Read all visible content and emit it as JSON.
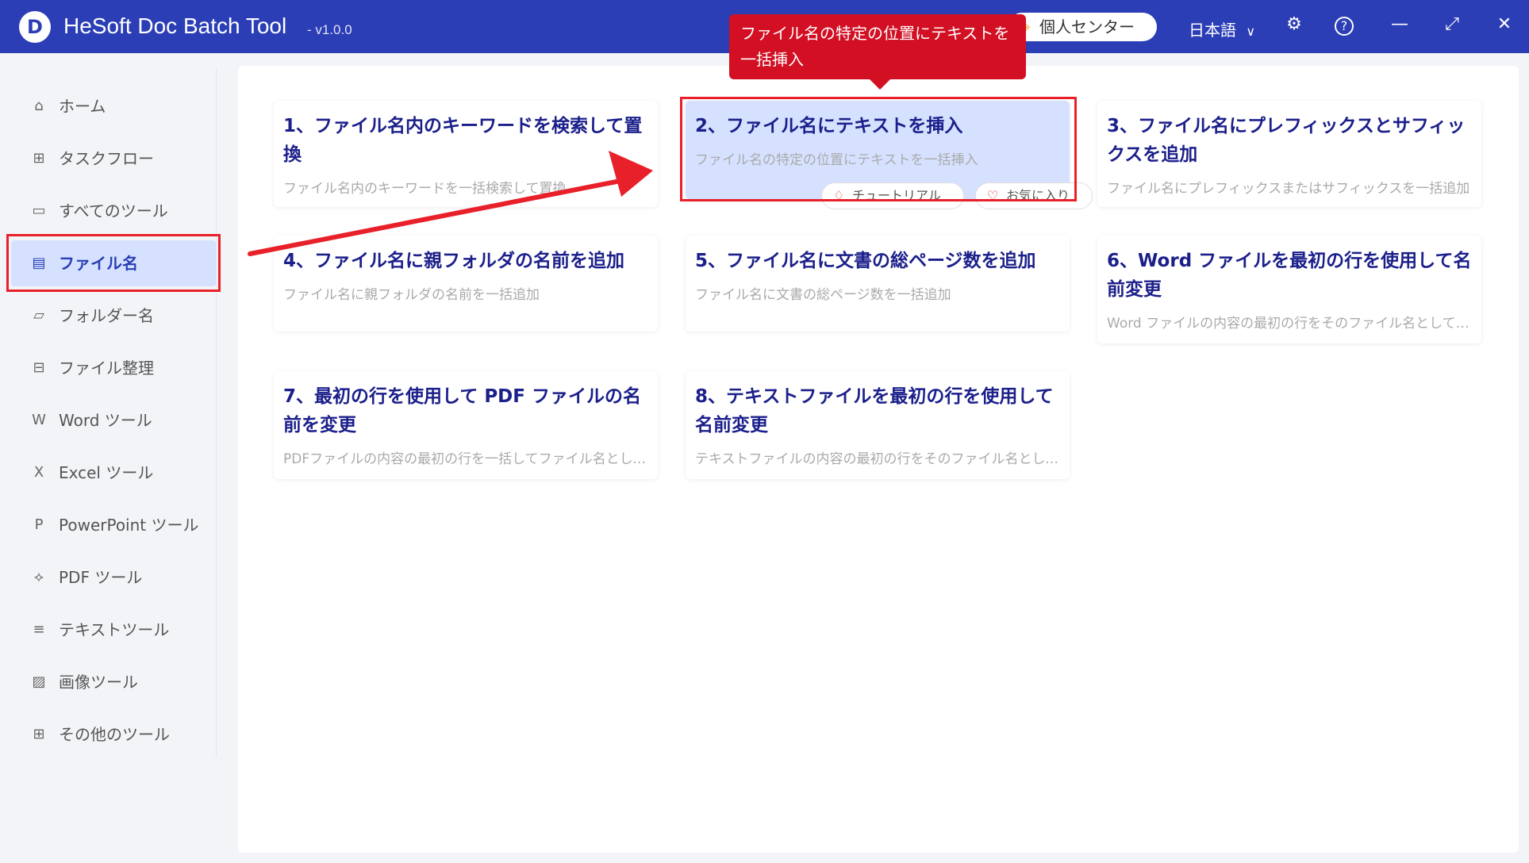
{
  "app": {
    "title": "HeSoft Doc Batch Tool",
    "version": "- v1.0.0",
    "logo_letter": "D",
    "user_center": "個人センター",
    "language": "日本語",
    "accent": "#2b3eb5"
  },
  "icons": {
    "crown": "◈",
    "chevron": "∨",
    "gear": "⚙",
    "help": "?",
    "minimize": "—",
    "maximize": "⤢",
    "close": "✕",
    "home": "⌂",
    "taskflow": "⊞",
    "monitor": "▭",
    "file": "▤",
    "folder": "▱",
    "organize": "⊟",
    "word": "W",
    "excel": "X",
    "ppt": "P",
    "pdf": "⟡",
    "text": "≡",
    "image": "▨",
    "grid": "⊞",
    "bulb": "♢",
    "heart": "♡"
  },
  "sidebar": {
    "items": [
      {
        "label": "ホーム"
      },
      {
        "label": "タスクフロー"
      },
      {
        "label": "すべてのツール"
      },
      {
        "label": "ファイル名"
      },
      {
        "label": "フォルダー名"
      },
      {
        "label": "ファイル整理"
      },
      {
        "label": "Word ツール"
      },
      {
        "label": "Excel ツール"
      },
      {
        "label": "PowerPoint ツール"
      },
      {
        "label": "PDF ツール"
      },
      {
        "label": "テキストツール"
      },
      {
        "label": "画像ツール"
      },
      {
        "label": "その他のツール"
      }
    ]
  },
  "cards": [
    {
      "title": "1、ファイル名内のキーワードを検索して置換",
      "desc": "ファイル名内のキーワードを一括検索して置換"
    },
    {
      "title": "2、ファイル名にテキストを挿入",
      "desc": "ファイル名の特定の位置にテキストを一括挿入"
    },
    {
      "title": "3、ファイル名にプレフィックスとサフィックスを追加",
      "desc": "ファイル名にプレフィックスまたはサフィックスを一括追加"
    },
    {
      "title": "4、ファイル名に親フォルダの名前を追加",
      "desc": "ファイル名に親フォルダの名前を一括追加"
    },
    {
      "title": "5、ファイル名に文書の総ページ数を追加",
      "desc": "ファイル名に文書の総ページ数を一括追加"
    },
    {
      "title": "6、Word ファイルを最初の行を使用して名前変更",
      "desc": "Word ファイルの内容の最初の行をそのファイル名として一括変更"
    },
    {
      "title": "7、最初の行を使用して PDF ファイルの名前を変更",
      "desc": "PDFファイルの内容の最初の行を一括してファイル名として変更"
    },
    {
      "title": "8、テキストファイルを最初の行を使用して名前変更",
      "desc": "テキストファイルの内容の最初の行をそのファイル名として一括変更"
    }
  ],
  "card_actions": {
    "tutorial": "チュートリアル",
    "favorite": "お気に入り"
  },
  "tooltip": {
    "text": "ファイル名の特定の位置にテキストを一括挿入"
  }
}
